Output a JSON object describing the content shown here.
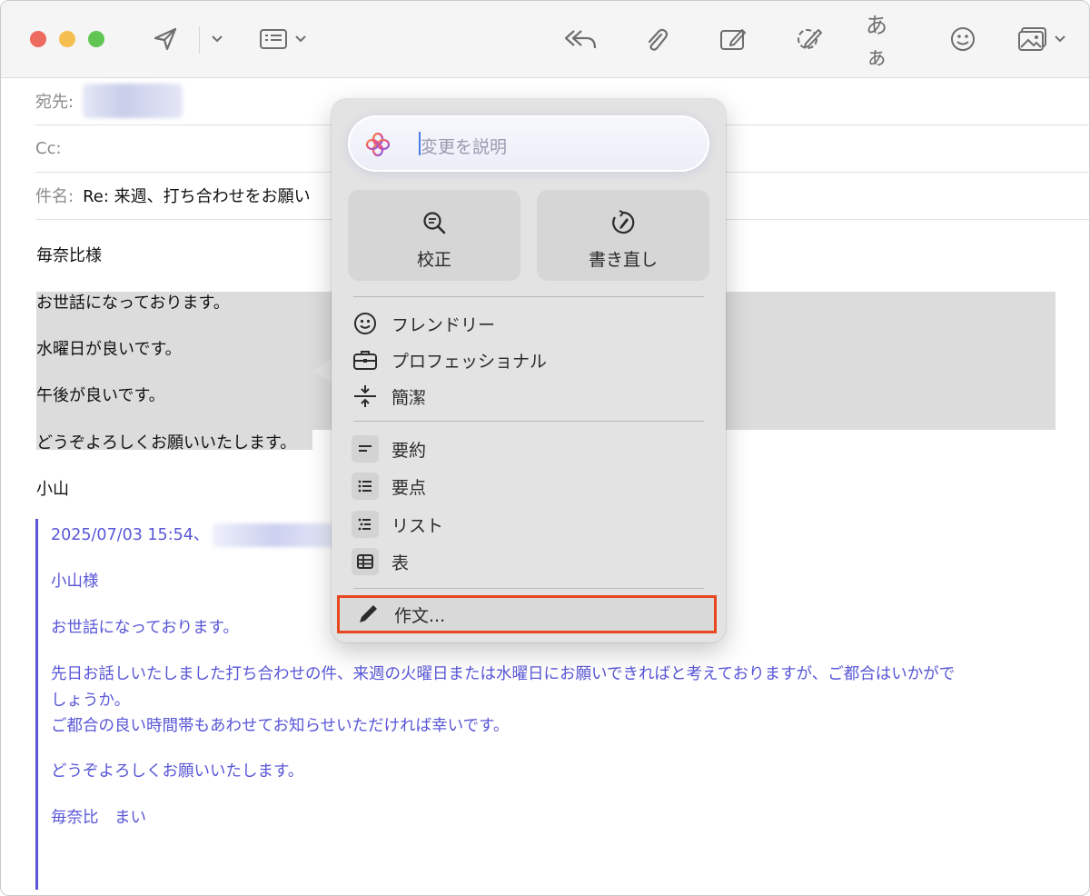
{
  "toolbar": {
    "icons": [
      "send-icon",
      "chevron-down-icon",
      "header-fields-icon",
      "chevron-down-icon",
      "reply-all-icon",
      "attachment-icon",
      "markup-icon",
      "writing-tools-icon",
      "format-icon",
      "emoji-icon",
      "photo-icon"
    ],
    "format_text": "あぁ"
  },
  "header": {
    "to_label": "宛先:",
    "cc_label": "Cc:",
    "subject_label": "件名:",
    "subject_value": "Re: 来週、打ち合わせをお願い"
  },
  "body": {
    "greeting": "毎奈比様",
    "selected_lines": [
      "お世話になっております。",
      "水曜日が良いです。",
      "午後が良いです。",
      "どうぞよろしくお願いいたします。"
    ],
    "signature": "小山"
  },
  "quote": {
    "date_line": "2025/07/03 15:54、",
    "salutation": "小山様",
    "line1": "お世話になっております。",
    "para_line1": "先日お話しいたしました打ち合わせの件、来週の火曜日または水曜日にお願いできればと考えておりますが、ご都合はいかがで",
    "para_line2": "しょうか。",
    "para_line3": "ご都合の良い時間帯もあわせてお知らせいただければ幸いです。",
    "closing": "どうぞよろしくお願いいたします。",
    "sender": "毎奈比　まい"
  },
  "writing_tools": {
    "prompt_placeholder": "変更を説明",
    "proofread_label": "校正",
    "rewrite_label": "書き直し",
    "tone_items": [
      "フレンドリー",
      "プロフェッショナル",
      "簡潔"
    ],
    "format_items": [
      "要約",
      "要点",
      "リスト",
      "表"
    ],
    "compose_label": "作文...",
    "highlight_color": "#e8461e"
  },
  "colors": {
    "quote": "#5856d6",
    "selection": "#dcdcdc"
  }
}
